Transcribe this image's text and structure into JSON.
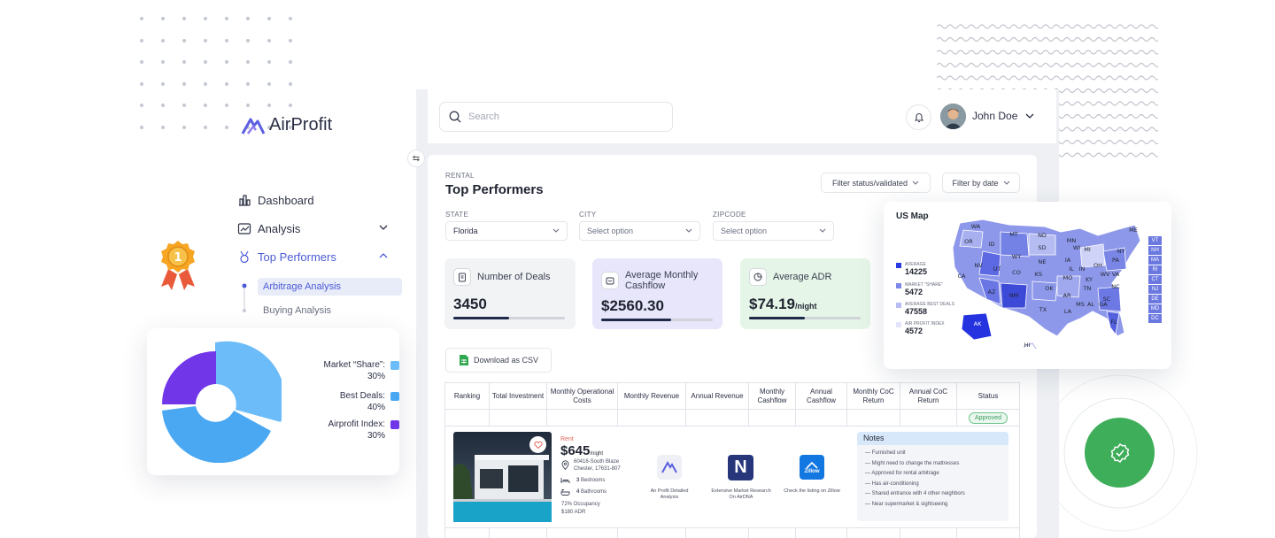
{
  "brand": {
    "name": "AirProfit"
  },
  "sidebar": {
    "items": [
      {
        "label": "Dashboard"
      },
      {
        "label": "Analysis"
      },
      {
        "label": "Top Performers"
      }
    ],
    "subitems": [
      {
        "label": "Arbitrage Analysis"
      },
      {
        "label": "Buying Analysis"
      }
    ]
  },
  "header": {
    "search_placeholder": "Search",
    "user": "John Doe"
  },
  "page": {
    "eyebrow": "RENTAL",
    "title": "Top Performers",
    "filter_status": "Filter status/validated",
    "filter_date": "Filter by date",
    "filters": [
      {
        "label": "STATE",
        "value": "Florida"
      },
      {
        "label": "CITY",
        "value": "Select option"
      },
      {
        "label": "ZIPCODE",
        "value": "Select option"
      }
    ]
  },
  "stats": [
    {
      "label": "Number of Deals",
      "value": "3450",
      "suffix": "",
      "progress": 0.5,
      "bg": "#f2f3f5"
    },
    {
      "label": "Average Monthly Cashflow",
      "value": "$2560.30",
      "suffix": "",
      "progress": 0.63,
      "bg": "#e7e6fa"
    },
    {
      "label": "Average ADR",
      "value": "$74.19",
      "suffix": "/night",
      "progress": 0.5,
      "bg": "#e5f6e8"
    }
  ],
  "download": {
    "label": "Download as CSV"
  },
  "table": {
    "headers": [
      "Ranking",
      "Total Investment",
      "Monthly Operational Costs",
      "Monthly Revenue",
      "Annual Revenue",
      "Monthly Cashflow",
      "Annual Cashflow",
      "Monthly CoC Return",
      "Annual CoC Return",
      "Status"
    ],
    "status": "Approved"
  },
  "listing": {
    "tag": "Rent",
    "price": "$645",
    "unit": "/night",
    "address": "60416-South Blaze Chester, 17631-807",
    "bedrooms_count": "3",
    "bedrooms_label": "Bedrooms",
    "bathrooms_count": "4",
    "bathrooms_label": "Bathrooms",
    "occupancy": "72% Occupancy",
    "adr": "$180 ADR",
    "links": [
      {
        "label": "Air Profit Detailed Analysis"
      },
      {
        "label": "Extensive Market Research On AirDNA"
      },
      {
        "label": "Check the listing on Zillow"
      }
    ],
    "zillow_text": "Zillow",
    "notes_title": "Notes",
    "notes": [
      "— Furnished unit",
      "— Might need to change the mattresses",
      "— Approved for rental arbitrage",
      "— Has air-conditioning",
      "— Shared entrance with 4 other neighbors",
      "— Near supermarket & sightseeing"
    ]
  },
  "pie": {
    "legend": [
      {
        "label": "Market “Share”:",
        "value": "30%",
        "color": "#6bbcf8"
      },
      {
        "label": "Best Deals:",
        "value": "40%",
        "color": "#4aa8f2"
      },
      {
        "label": "Airprofit Index:",
        "value": "30%",
        "color": "#7036e8"
      }
    ]
  },
  "map": {
    "title": "US Map",
    "legend": [
      {
        "label": "AVERAGE",
        "value": "14225",
        "color": "#2b3ae0"
      },
      {
        "label": "MARKET \"SHARE\"",
        "value": "5472",
        "color": "#7d88e8"
      },
      {
        "label": "AVERAGE  BEST DEALS",
        "value": "47558",
        "color": "#b7bdf3"
      },
      {
        "label": "AIR PROFIT INDEX",
        "value": "4572",
        "color": "#e3e6fb"
      }
    ],
    "states": [
      "WA",
      "MT",
      "ND",
      "MN",
      "OR",
      "ID",
      "SD",
      "WI",
      "ME",
      "WY",
      "NE",
      "MI",
      "NY",
      "NV",
      "UT",
      "CO",
      "IA",
      "IL",
      "IN",
      "OH",
      "PA",
      "CA",
      "KS",
      "MO",
      "KY",
      "WV",
      "VA",
      "AZ",
      "NM",
      "OK",
      "TN",
      "NC",
      "AR",
      "SC",
      "TX",
      "LA",
      "MS",
      "AL",
      "GA",
      "FL",
      "AK",
      "HI"
    ],
    "northeast": [
      "VT",
      "NH",
      "MA",
      "RI",
      "CT",
      "NJ",
      "DE",
      "MD",
      "DC"
    ]
  },
  "colors": {
    "accent": "#4b5bd6",
    "success": "#3eae5a"
  }
}
